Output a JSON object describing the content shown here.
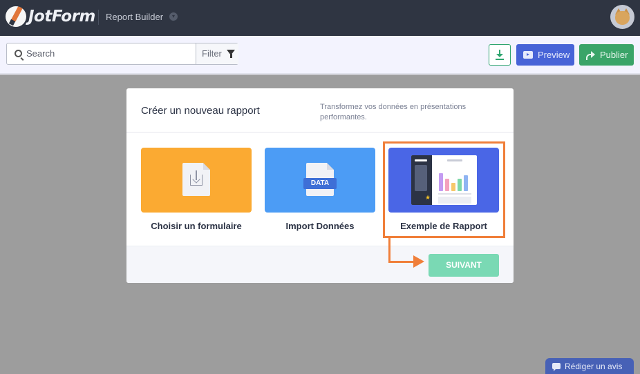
{
  "app": {
    "logo_text": "JotForm",
    "name": "Report Builder"
  },
  "toolbar": {
    "search_placeholder": "Search",
    "filter_label": "Filter",
    "preview_label": "Preview",
    "publish_label": "Publier"
  },
  "modal": {
    "title": "Créer un nouveau rapport",
    "subtitle": "Transformez vos données en présentations performantes.",
    "options": [
      {
        "label": "Choisir un formulaire",
        "icon": "form-download-icon",
        "color": "#fbaa32"
      },
      {
        "label": "Import Données",
        "icon": "data-file-icon",
        "badge": "DATA",
        "color": "#4c9cf5"
      },
      {
        "label": "Exemple de Rapport",
        "icon": "report-example-icon",
        "color": "#4a66e6",
        "selected": true
      }
    ],
    "next_label": "SUIVANT"
  },
  "feedback": {
    "label": "Rédiger un avis"
  },
  "colors": {
    "topbar": "#2f3542",
    "accent_highlight": "#f07f3a",
    "next_button": "#7ad9b4",
    "preview_button": "#4763d7",
    "publish_button": "#3aa468"
  }
}
